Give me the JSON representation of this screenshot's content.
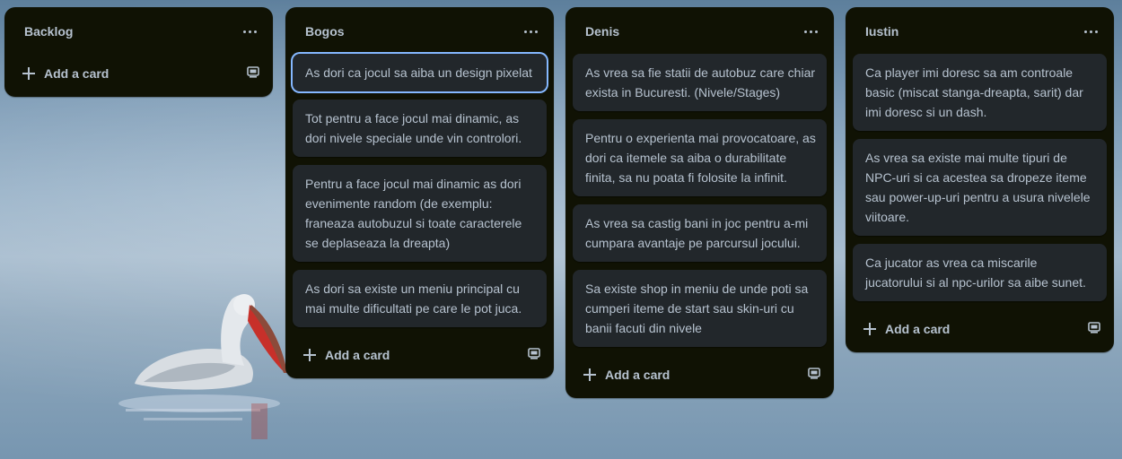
{
  "lists": [
    {
      "title": "Backlog",
      "add_label": "Add a card",
      "cards": []
    },
    {
      "title": "Bogos",
      "add_label": "Add a card",
      "cards": [
        "As dori ca jocul sa aiba un design pixelat",
        "Tot pentru a face jocul mai dinamic, as dori nivele speciale unde vin controlori.",
        "Pentru a face jocul mai dinamic as dori evenimente random (de exemplu: franeaza autobuzul si toate caracterele se deplaseaza la dreapta)",
        "As dori sa existe un meniu principal cu mai multe dificultati pe care le pot juca."
      ]
    },
    {
      "title": "Denis",
      "add_label": "Add a card",
      "cards": [
        "As vrea sa fie statii de autobuz care chiar exista in Bucuresti. (Nivele/Stages)",
        "Pentru o experienta mai provocatoare, as dori ca itemele sa aiba o durabilitate finita, sa nu poata fi folosite la infinit.",
        "As vrea sa castig bani in joc pentru a-mi cumpara avantaje pe parcursul jocului.",
        "Sa existe shop in meniu de unde poti sa cumperi iteme de start sau skin-uri cu banii facuti din nivele"
      ]
    },
    {
      "title": "Iustin",
      "add_label": "Add a card",
      "cards": [
        "Ca player imi doresc sa am controale basic (miscat stanga-dreapta, sarit) dar imi doresc si un dash.",
        "As vrea sa existe mai multe tipuri de NPC-uri si ca acestea sa dropeze iteme sau power-up-uri pentru a usura nivelele viitoare.",
        "Ca jucator as vrea ca miscarile jucatorului si al npc-urilor sa aibe sunet."
      ]
    }
  ],
  "icons": {
    "list_menu": "more-icon",
    "add": "plus-icon",
    "template": "card-template-icon"
  },
  "colors": {
    "list_bg": "#101204",
    "card_bg": "#22272b",
    "text": "#b6c2cf",
    "focus": "#85b8ff"
  }
}
